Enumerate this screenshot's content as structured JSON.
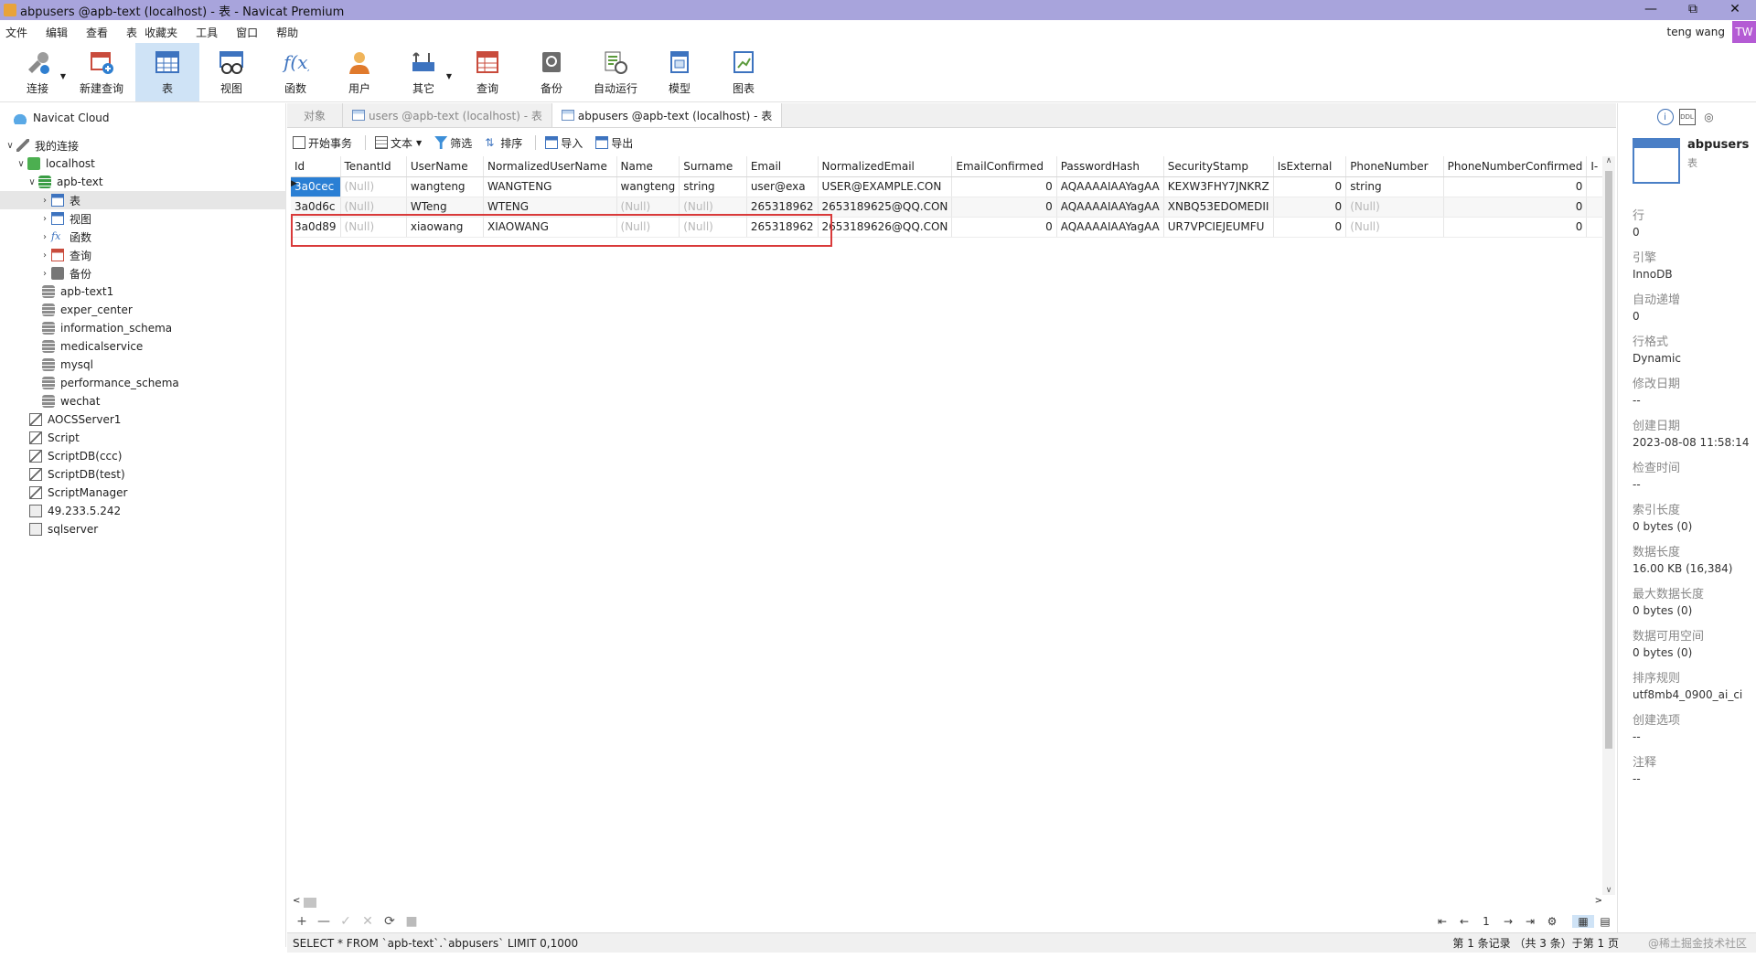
{
  "window": {
    "title": "abpusers @apb-text (localhost) - 表 - Navicat Premium"
  },
  "menu": [
    "文件",
    "编辑",
    "查看",
    "表",
    "收藏夹",
    "工具",
    "窗口",
    "帮助"
  ],
  "user": {
    "name": "teng wang",
    "initials": "TW"
  },
  "toolbar": [
    {
      "label": "连接",
      "icon": "connection-icon",
      "dropdown": true
    },
    {
      "label": "新建查询",
      "icon": "new-query-icon"
    },
    {
      "label": "表",
      "icon": "table-icon",
      "active": true
    },
    {
      "label": "视图",
      "icon": "view-icon"
    },
    {
      "label": "函数",
      "icon": "function-icon"
    },
    {
      "label": "用户",
      "icon": "user-icon"
    },
    {
      "label": "其它",
      "icon": "tools-icon",
      "dropdown": true
    },
    {
      "label": "查询",
      "icon": "query-icon"
    },
    {
      "label": "备份",
      "icon": "backup-icon"
    },
    {
      "label": "自动运行",
      "icon": "schedule-icon"
    },
    {
      "label": "模型",
      "icon": "model-icon"
    },
    {
      "label": "图表",
      "icon": "chart-icon"
    }
  ],
  "tree": {
    "cloud": "Navicat Cloud",
    "my_connections": "我的连接",
    "localhost": "localhost",
    "apb_text": "apb-text",
    "apb_children": [
      "表",
      "视图",
      "函数",
      "查询",
      "备份"
    ],
    "databases": [
      "apb-text1",
      "exper_center",
      "information_schema",
      "medicalservice",
      "mysql",
      "performance_schema",
      "wechat"
    ],
    "connections": [
      "AOCSServer1",
      "Script",
      "ScriptDB(ccc)",
      "ScriptDB(test)",
      "ScriptManager",
      "49.233.5.242",
      "sqlserver"
    ]
  },
  "tabs": {
    "objects": "对象",
    "tab1": "users @apb-text (localhost) - 表",
    "tab2": "abpusers @apb-text (localhost) - 表"
  },
  "subtoolbar": {
    "begin_tx": "开始事务",
    "text": "文本",
    "filter": "筛选",
    "sort": "排序",
    "import": "导入",
    "export": "导出"
  },
  "grid": {
    "columns": [
      "Id",
      "TenantId",
      "UserName",
      "NormalizedUserName",
      "Name",
      "Surname",
      "Email",
      "NormalizedEmail",
      "EmailConfirmed",
      "PasswordHash",
      "SecurityStamp",
      "IsExternal",
      "PhoneNumber",
      "PhoneNumberConfirmed",
      "I-"
    ],
    "rows": [
      [
        "3a0cec",
        "(Null)",
        "wangteng",
        "WANGTENG",
        "wangteng",
        "string",
        "user@exa",
        "USER@EXAMPLE.CON",
        "0",
        "AQAAAAIAAYagAA",
        "KEXW3FHY7JNKRZ",
        "0",
        "string",
        "0",
        ""
      ],
      [
        "3a0d6c",
        "(Null)",
        "WTeng",
        "WTENG",
        "(Null)",
        "(Null)",
        "265318962",
        "2653189625@QQ.CON",
        "0",
        "AQAAAAIAAYagAA",
        "XNBQ53EDOMEDII",
        "0",
        "(Null)",
        "0",
        ""
      ],
      [
        "3a0d89",
        "(Null)",
        "xiaowang",
        "XIAOWANG",
        "(Null)",
        "(Null)",
        "265318962",
        "2653189626@QQ.CON",
        "0",
        "AQAAAAIAAYagAA",
        "UR7VPCIEJEUMFU",
        "0",
        "(Null)",
        "0",
        ""
      ]
    ]
  },
  "nav": {
    "page": "1"
  },
  "status": {
    "sql": "SELECT * FROM `apb-text`.`abpusers` LIMIT 0,1000",
    "records": "第 1 条记录 （共 3 条）于第 1 页",
    "watermark": "@稀土掘金技术社区"
  },
  "info": {
    "name": "abpusers",
    "type": "表",
    "props": [
      {
        "k": "行",
        "v": "0"
      },
      {
        "k": "引擎",
        "v": "InnoDB"
      },
      {
        "k": "自动递增",
        "v": "0"
      },
      {
        "k": "行格式",
        "v": "Dynamic"
      },
      {
        "k": "修改日期",
        "v": "--"
      },
      {
        "k": "创建日期",
        "v": "2023-08-08 11:58:14"
      },
      {
        "k": "检查时间",
        "v": "--"
      },
      {
        "k": "索引长度",
        "v": "0 bytes (0)"
      },
      {
        "k": "数据长度",
        "v": "16.00 KB (16,384)"
      },
      {
        "k": "最大数据长度",
        "v": "0 bytes (0)"
      },
      {
        "k": "数据可用空间",
        "v": "0 bytes (0)"
      },
      {
        "k": "排序规则",
        "v": "utf8mb4_0900_ai_ci"
      },
      {
        "k": "创建选项",
        "v": "--"
      },
      {
        "k": "注释",
        "v": "--"
      }
    ]
  },
  "colors": {
    "titlebar": "#a8a4dc",
    "selection": "#2a7fd4",
    "highlight_box": "#d93a3a"
  }
}
